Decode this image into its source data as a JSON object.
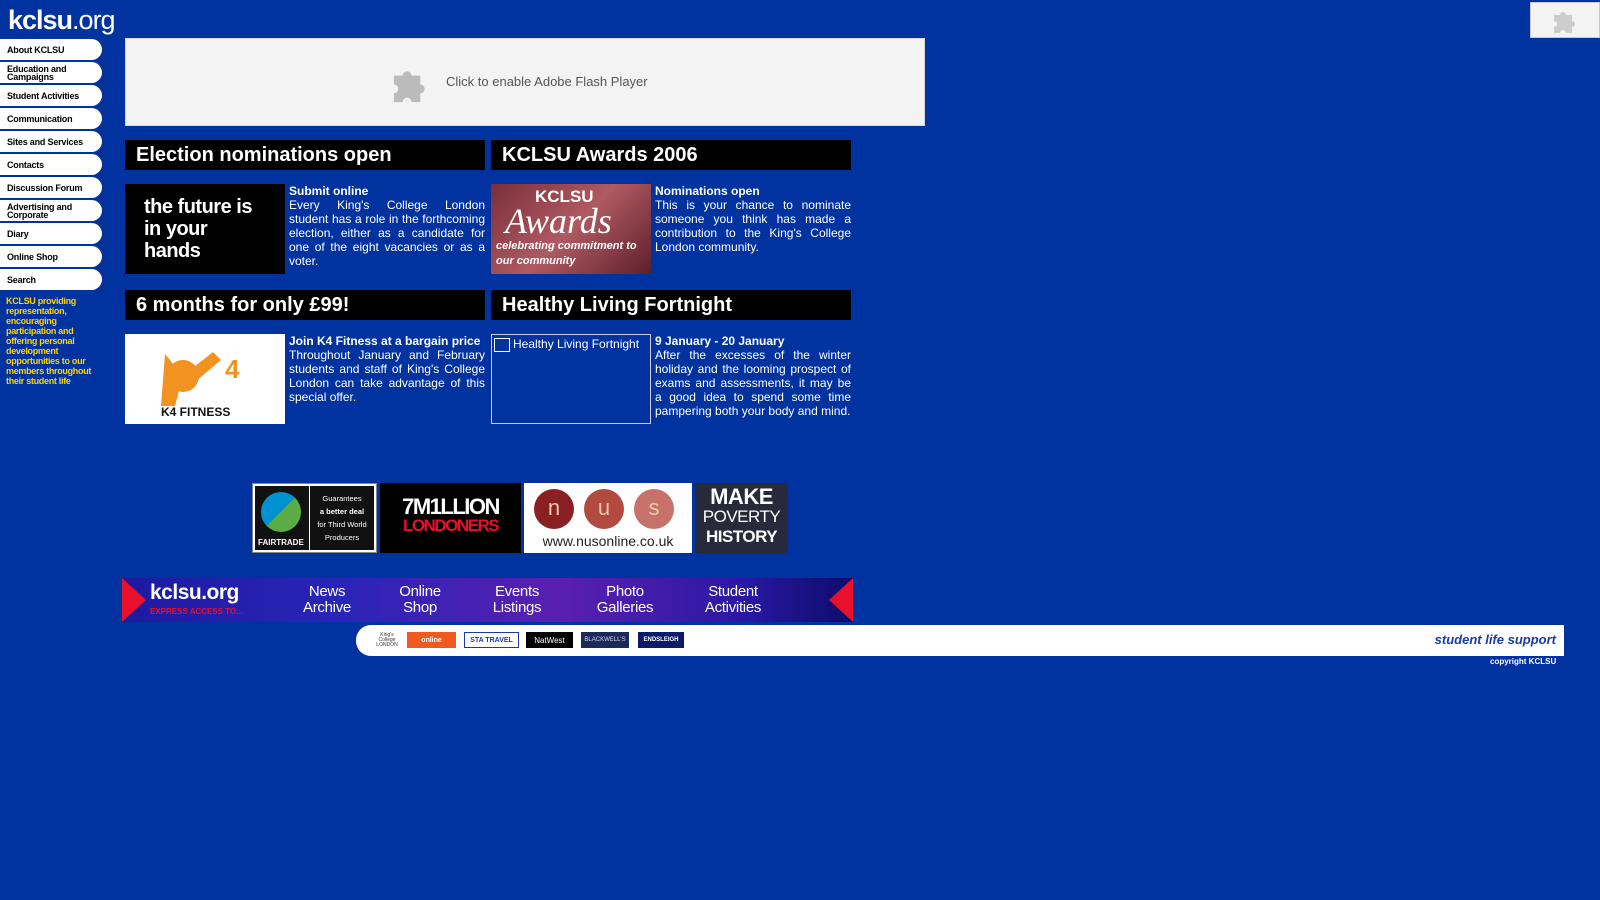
{
  "site": {
    "logo_main": "kclsu",
    "logo_suffix": ".org"
  },
  "sidebar": {
    "items": [
      {
        "label": "About KCLSU"
      },
      {
        "label": "Education and Campaigns"
      },
      {
        "label": "Student Activities"
      },
      {
        "label": "Communication"
      },
      {
        "label": "Sites and Services"
      },
      {
        "label": "Contacts"
      },
      {
        "label": "Discussion Forum"
      },
      {
        "label": "Advertising and Corporate"
      },
      {
        "label": "Diary"
      },
      {
        "label": "Online Shop"
      },
      {
        "label": "Search"
      }
    ],
    "tagline": "KCLSU providing representation, encouraging participation and offering personal development opportunities to our members throughout their student life"
  },
  "flash": {
    "text": "Click to enable Adobe Flash Player",
    "icon": "puzzle-piece-icon"
  },
  "news": [
    {
      "header": "Election nominations open",
      "image_text": "the future is in your hands",
      "subtitle": "Submit online",
      "body": "Every King's College London student has a role in the forthcoming election, either as a candidate for one of the eight vacancies or as a voter."
    },
    {
      "header": "KCLSU Awards 2006",
      "image_text_top": "KCLSU",
      "image_text_mid": "Awards",
      "image_text_bottom": "celebrating commitment to our community",
      "subtitle": "Nominations open",
      "body": "This is your chance to nominate someone you think has made a contribution to the King's College London community."
    },
    {
      "header": "6 months for only £99!",
      "image_text": "K4 FITNESS",
      "subtitle": "Join K4 Fitness at a bargain price",
      "body": "Throughout January and February students and staff of King's College London can take advantage of this special offer."
    },
    {
      "header": "Healthy Living Fortnight",
      "image_alt": "Healthy Living Fortnight",
      "subtitle": "9 January - 20 January",
      "body": "After the excesses of the winter holiday and the looming prospect of exams and assessments, it may be a good idea to spend some time pampering both your body and mind."
    }
  ],
  "partners": {
    "fairtrade_line1": "Guarantees",
    "fairtrade_line2": "a better deal",
    "fairtrade_line3": "for Third World",
    "fairtrade_line4": "Producers",
    "fairtrade_brand": "FAIRTRADE",
    "million_top": "7M1LLION",
    "million_bottom": "LONDONERS",
    "nus_n": "n",
    "nus_u": "u",
    "nus_s": "s",
    "nus_url": "www.nusonline.co.uk",
    "poverty_1": "MAKE",
    "poverty_2": "POVERTY",
    "poverty_3": "HISTORY"
  },
  "bottom_bar": {
    "logo": "kclsu.org",
    "logo_sub": "EXPRESS ACCESS TO...",
    "links": [
      {
        "line1": "News",
        "line2": "Archive"
      },
      {
        "line1": "Online",
        "line2": "Shop"
      },
      {
        "line1": "Events",
        "line2": "Listings"
      },
      {
        "line1": "Photo",
        "line2": "Galleries"
      },
      {
        "line1": "Student",
        "line2": "Activities"
      }
    ]
  },
  "sponsors": {
    "kings": "King's College LONDON",
    "online": "online",
    "sta": "STA TRAVEL",
    "natwest": "NatWest",
    "blackwells": "BLACKWELL'S",
    "endsleigh": "ENDSLEIGH",
    "tagline": "student life support"
  },
  "copyright": "copyright KCLSU",
  "colors": {
    "background": "#0033a0",
    "tagline": "#ffd400",
    "header_bg": "#000000",
    "bar_arrow": "#e8102a"
  }
}
